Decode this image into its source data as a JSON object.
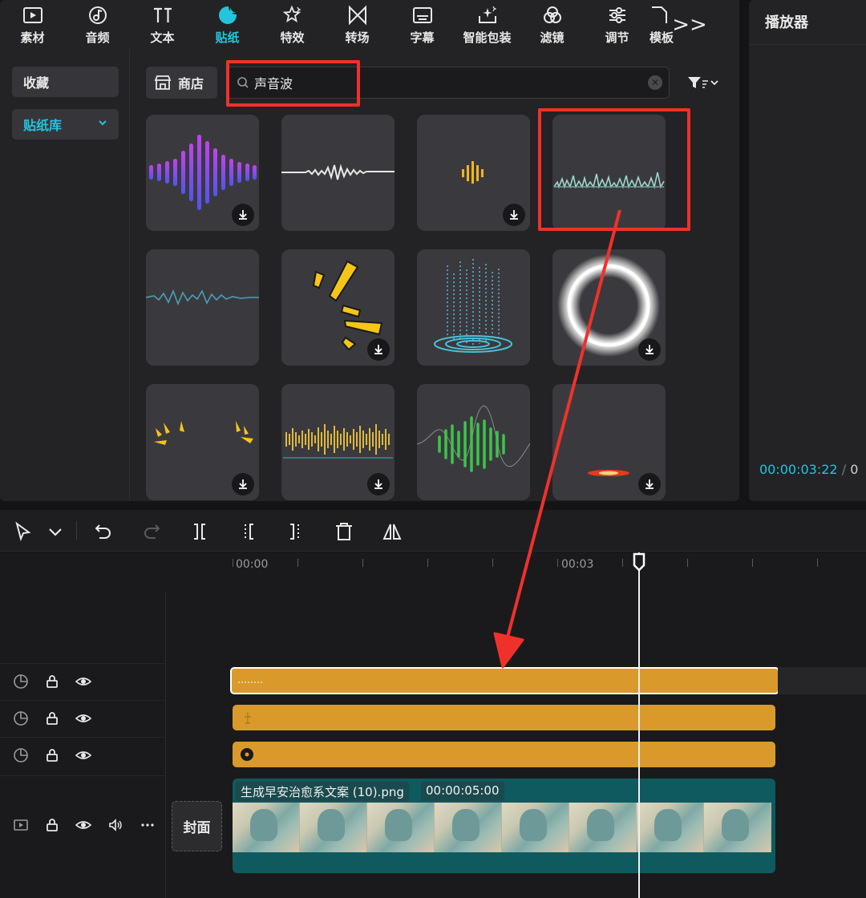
{
  "tabs": [
    {
      "label": "素材",
      "icon": "media-icon"
    },
    {
      "label": "音频",
      "icon": "audio-icon"
    },
    {
      "label": "文本",
      "icon": "text-icon"
    },
    {
      "label": "贴纸",
      "icon": "sticker-icon"
    },
    {
      "label": "特效",
      "icon": "effects-icon"
    },
    {
      "label": "转场",
      "icon": "transition-icon"
    },
    {
      "label": "字幕",
      "icon": "subtitle-icon"
    },
    {
      "label": "智能包装",
      "icon": "smart-pack-icon"
    },
    {
      "label": "滤镜",
      "icon": "filter-icon"
    },
    {
      "label": "调节",
      "icon": "adjust-icon"
    },
    {
      "label": "模板",
      "icon": "template-icon"
    }
  ],
  "active_tab": "贴纸",
  "more_label": ">>",
  "sidebar": {
    "favorites_label": "收藏",
    "library_label": "贴纸库"
  },
  "shop": {
    "label": "商店"
  },
  "search": {
    "value": "声音波",
    "clear_symbol": "✕"
  },
  "stickers": [
    {
      "name": "purple-waveform",
      "downloadable": true
    },
    {
      "name": "white-line-waveform",
      "downloadable": false
    },
    {
      "name": "small-yellow-bars",
      "downloadable": true
    },
    {
      "name": "teal-mini-waveform",
      "downloadable": false,
      "highlighted": true
    },
    {
      "name": "teal-line-waveform",
      "downloadable": false
    },
    {
      "name": "yellow-burst",
      "downloadable": true
    },
    {
      "name": "digital-rain-rings",
      "downloadable": false
    },
    {
      "name": "glowing-ring",
      "downloadable": true
    },
    {
      "name": "yellow-corner-bursts",
      "downloadable": true
    },
    {
      "name": "gold-waveform",
      "downloadable": true
    },
    {
      "name": "green-waveform",
      "downloadable": false
    },
    {
      "name": "red-spark",
      "downloadable": true
    }
  ],
  "player": {
    "title": "播放器",
    "current_time": "00:00:03:22",
    "separator": "/",
    "total_time_partial": "0"
  },
  "ruler": {
    "labels": [
      "00:00",
      "00:03"
    ]
  },
  "timeline": {
    "cover_label": "封面",
    "video_clip": {
      "filename": "生成早安治愈系文案 (10).png",
      "duration": "00:00:05:00"
    },
    "clip_colors": {
      "sticker": "#d99a2b",
      "video": "#0f5a5e",
      "accent": "#22c5dc",
      "highlight": "#f0312a"
    }
  }
}
